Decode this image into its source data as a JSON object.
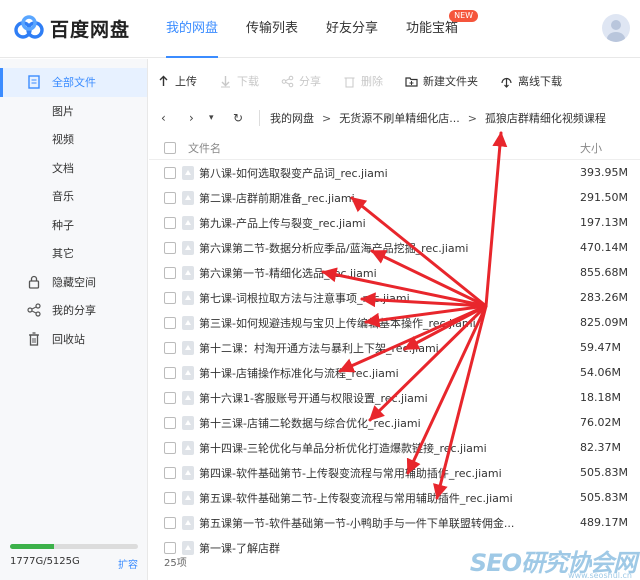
{
  "app": {
    "name": "百度网盘"
  },
  "nav": {
    "items": [
      {
        "label": "我的网盘"
      },
      {
        "label": "传输列表"
      },
      {
        "label": "好友分享"
      },
      {
        "label": "功能宝箱"
      }
    ],
    "badge": "NEW"
  },
  "sidebar": {
    "items": [
      {
        "label": "全部文件"
      },
      {
        "label": "图片"
      },
      {
        "label": "视频"
      },
      {
        "label": "文档"
      },
      {
        "label": "音乐"
      },
      {
        "label": "种子"
      },
      {
        "label": "其它"
      },
      {
        "label": "隐藏空间"
      },
      {
        "label": "我的分享"
      },
      {
        "label": "回收站"
      }
    ],
    "storage": {
      "text": "1777G/5125G",
      "used_fraction": 0.347,
      "expand_label": "扩容"
    }
  },
  "toolbar": {
    "upload": "上传",
    "download": "下载",
    "share": "分享",
    "delete": "删除",
    "new_folder": "新建文件夹",
    "offline_download": "离线下载"
  },
  "breadcrumb": {
    "items": [
      "我的网盘",
      "无货源不刷单精细化店...",
      "孤狼店群精细化视频课程"
    ]
  },
  "list": {
    "header_name": "文件名",
    "header_size": "大小",
    "rows": [
      {
        "name": "第八课-如何选取裂变产品词_rec.jiami",
        "size": "393.95M"
      },
      {
        "name": "第二课-店群前期准备_rec.jiami",
        "size": "291.50M"
      },
      {
        "name": "第九课-产品上传与裂变_rec.jiami",
        "size": "197.13M"
      },
      {
        "name": "第六课第二节-数据分析应季品/蓝海产品挖掘_rec.jiami",
        "size": "470.14M"
      },
      {
        "name": "第六课第一节-精细化选品_rec.jiami",
        "size": "855.68M"
      },
      {
        "name": "第七课-词根拉取方法与注意事项_rec.jiami",
        "size": "283.26M"
      },
      {
        "name": "第三课-如何规避违规与宝贝上传编辑基本操作_rec.jiami",
        "size": "825.09M"
      },
      {
        "name": "第十二课：村淘开通方法与暴利上下架_rec.jiami",
        "size": "59.47M"
      },
      {
        "name": "第十课-店铺操作标准化与流程_rec.jiami",
        "size": "54.06M"
      },
      {
        "name": "第十六课1-客服账号开通与权限设置_rec.jiami",
        "size": "18.18M"
      },
      {
        "name": "第十三课-店铺二轮数据与综合优化_rec.jiami",
        "size": "76.02M"
      },
      {
        "name": "第十四课-三轮优化与单品分析优化打造爆款链接_rec.jiami",
        "size": "82.37M"
      },
      {
        "name": "第四课-软件基础第节-上传裂变流程与常用辅助插件_rec.jiami",
        "size": "505.83M"
      },
      {
        "name": "第五课-软件基础第二节-上传裂变流程与常用辅助插件_rec.jiami",
        "size": "505.83M"
      },
      {
        "name": "第五课第一节-软件基础第一节-小鸭助手与一件下单联盟转佣金...",
        "size": "489.17M"
      },
      {
        "name": "第一课-了解店群",
        "size": ""
      }
    ],
    "footer": "25项"
  },
  "watermark": {
    "main": "SEO研究协会网",
    "sub": "www.seoshul.cn"
  },
  "colors": {
    "accent": "#3b8cff",
    "arrow": "#e8262c",
    "storage": "#3cb14a"
  }
}
